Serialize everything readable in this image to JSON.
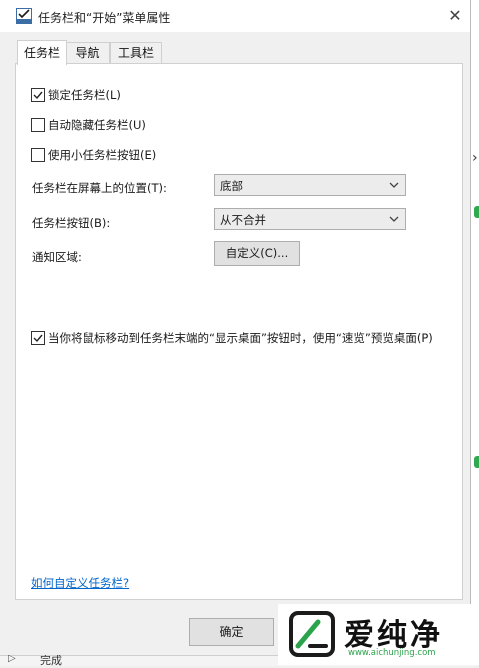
{
  "window": {
    "title": "任务栏和“开始”菜单属性",
    "close_glyph": "✕"
  },
  "tabs": [
    {
      "label": "任务栏",
      "active": true
    },
    {
      "label": "导航",
      "active": false
    },
    {
      "label": "工具栏",
      "active": false
    }
  ],
  "options": {
    "lock": {
      "label": "锁定任务栏(L)",
      "checked": true
    },
    "autohide": {
      "label": "自动隐藏任务栏(U)",
      "checked": false
    },
    "small_buttons": {
      "label": "使用小任务栏按钮(E)",
      "checked": false
    },
    "peek": {
      "label": "当你将鼠标移动到任务栏末端的“显示桌面”按钮时，使用“速览”预览桌面(P)",
      "checked": true
    }
  },
  "position": {
    "label": "任务栏在屏幕上的位置(T):",
    "value": "底部"
  },
  "buttons_combine": {
    "label": "任务栏按钮(B):",
    "value": "从不合并"
  },
  "notify": {
    "label": "通知区域:",
    "button": "自定义(C)..."
  },
  "help_link": "如何自定义任务栏?",
  "footer": {
    "ok": "确定"
  },
  "background": {
    "bottom_text": "完成"
  },
  "watermark": {
    "brand": "爱纯净",
    "url": "www.aichunjing.com"
  },
  "colors": {
    "accent": "#0066cc",
    "brand_green": "#2aa34a"
  }
}
